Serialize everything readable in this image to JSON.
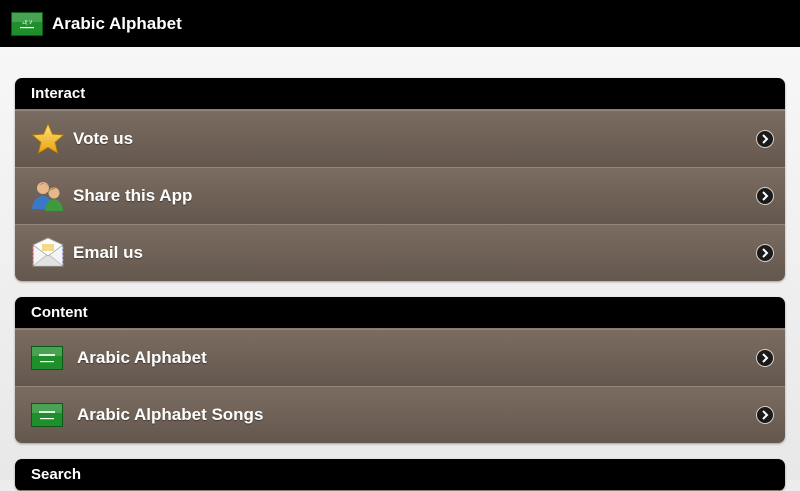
{
  "app": {
    "title": "Arabic Alphabet",
    "icon": "saudi-flag-icon",
    "flag_color": "#1f8f2c"
  },
  "sections": {
    "interact": {
      "title": "Interact",
      "items": [
        {
          "label": "Vote us",
          "icon": "star-icon"
        },
        {
          "label": "Share this App",
          "icon": "people-icon"
        },
        {
          "label": "Email us",
          "icon": "envelope-icon"
        }
      ]
    },
    "content": {
      "title": "Content",
      "items": [
        {
          "label": "Arabic Alphabet",
          "icon": "saudi-flag-icon"
        },
        {
          "label": "Arabic Alphabet Songs",
          "icon": "saudi-flag-icon"
        }
      ]
    },
    "search": {
      "title": "Search"
    }
  },
  "colors": {
    "row_top": "#7a6c61",
    "row_bottom": "#64574d",
    "header_bg": "#000000"
  }
}
